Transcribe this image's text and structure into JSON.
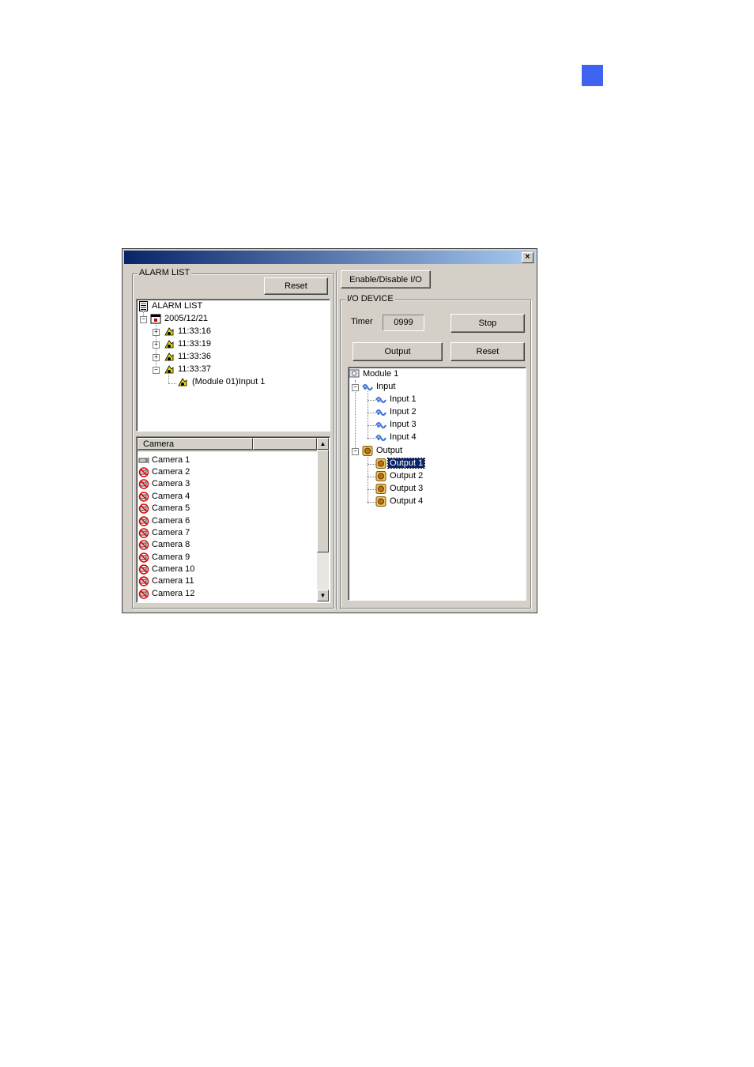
{
  "colors": {
    "accent": "#3e63f0",
    "selection": "#0a246a"
  },
  "window": {
    "close_glyph": "×"
  },
  "alarm_panel": {
    "group_title": "ALARM LIST",
    "reset_label": "Reset",
    "tree": {
      "root": "ALARM LIST",
      "date": "2005/12/21",
      "times": [
        "11:33:16",
        "11:33:19",
        "11:33:36",
        "11:33:37"
      ],
      "child": "(Module 01)Input 1"
    },
    "camera_list": {
      "column_header": "Camera",
      "items": [
        "Camera 1",
        "Camera 2",
        "Camera 3",
        "Camera 4",
        "Camera 5",
        "Camera 6",
        "Camera 7",
        "Camera 8",
        "Camera 9",
        "Camera 10",
        "Camera 11",
        "Camera 12"
      ]
    }
  },
  "io_panel": {
    "enable_label": "Enable/Disable I/O",
    "group_title": "I/O DEVICE",
    "timer_label": "Timer",
    "timer_value": "0999",
    "stop_label": "Stop",
    "output_label": "Output",
    "reset_label": "Reset",
    "tree": {
      "module": "Module 1",
      "input_group": "Input",
      "inputs": [
        "Input 1",
        "Input 2",
        "Input 3",
        "Input 4"
      ],
      "output_group": "Output",
      "outputs": [
        "Output 1",
        "Output 2",
        "Output 3",
        "Output 4"
      ],
      "selected_output": "Output 1"
    }
  },
  "icons": {
    "alarm_list_root": "list-document-icon",
    "date": "calendar-icon",
    "alarm_time": "alarm-bell-icon",
    "camera_active": "camera-icon",
    "camera_disabled": "camera-disabled-icon",
    "module": "io-module-icon",
    "input": "input-signal-icon",
    "output": "output-bulb-icon"
  }
}
